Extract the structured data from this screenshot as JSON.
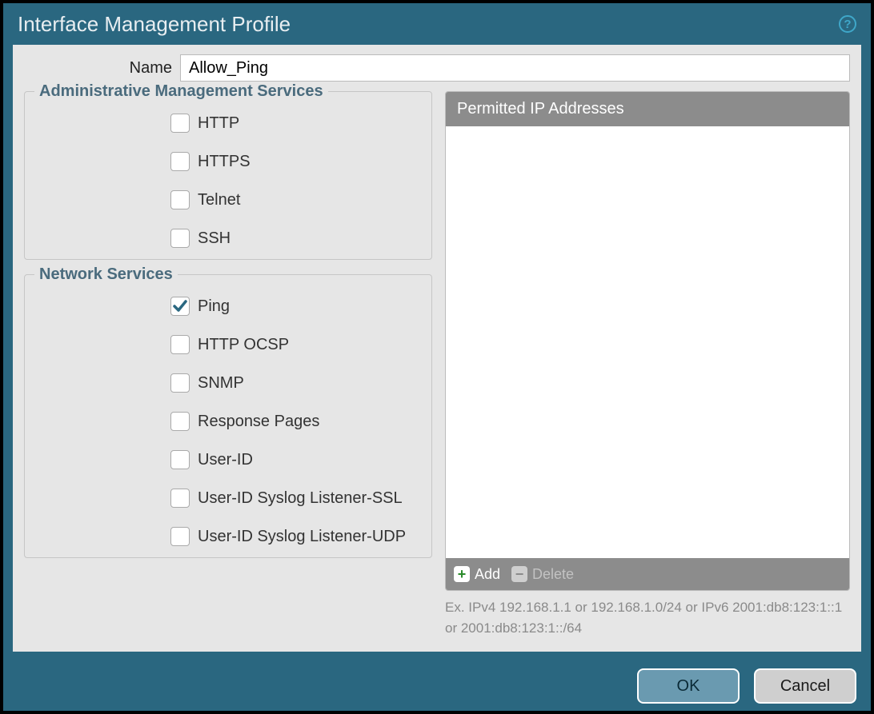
{
  "title": "Interface Management Profile",
  "name_label": "Name",
  "name_value": "Allow_Ping",
  "admin_section_title": "Administrative Management Services",
  "admin_services": [
    {
      "label": "HTTP",
      "checked": false
    },
    {
      "label": "HTTPS",
      "checked": false
    },
    {
      "label": "Telnet",
      "checked": false
    },
    {
      "label": "SSH",
      "checked": false
    }
  ],
  "network_section_title": "Network Services",
  "network_services": [
    {
      "label": "Ping",
      "checked": true
    },
    {
      "label": "HTTP OCSP",
      "checked": false
    },
    {
      "label": "SNMP",
      "checked": false
    },
    {
      "label": "Response Pages",
      "checked": false
    },
    {
      "label": "User-ID",
      "checked": false
    },
    {
      "label": "User-ID Syslog Listener-SSL",
      "checked": false
    },
    {
      "label": "User-ID Syslog Listener-UDP",
      "checked": false
    }
  ],
  "ip_header": "Permitted IP Addresses",
  "add_label": "Add",
  "delete_label": "Delete",
  "ip_hint": "Ex. IPv4 192.168.1.1 or 192.168.1.0/24 or IPv6 2001:db8:123:1::1 or 2001:db8:123:1::/64",
  "ok_label": "OK",
  "cancel_label": "Cancel"
}
